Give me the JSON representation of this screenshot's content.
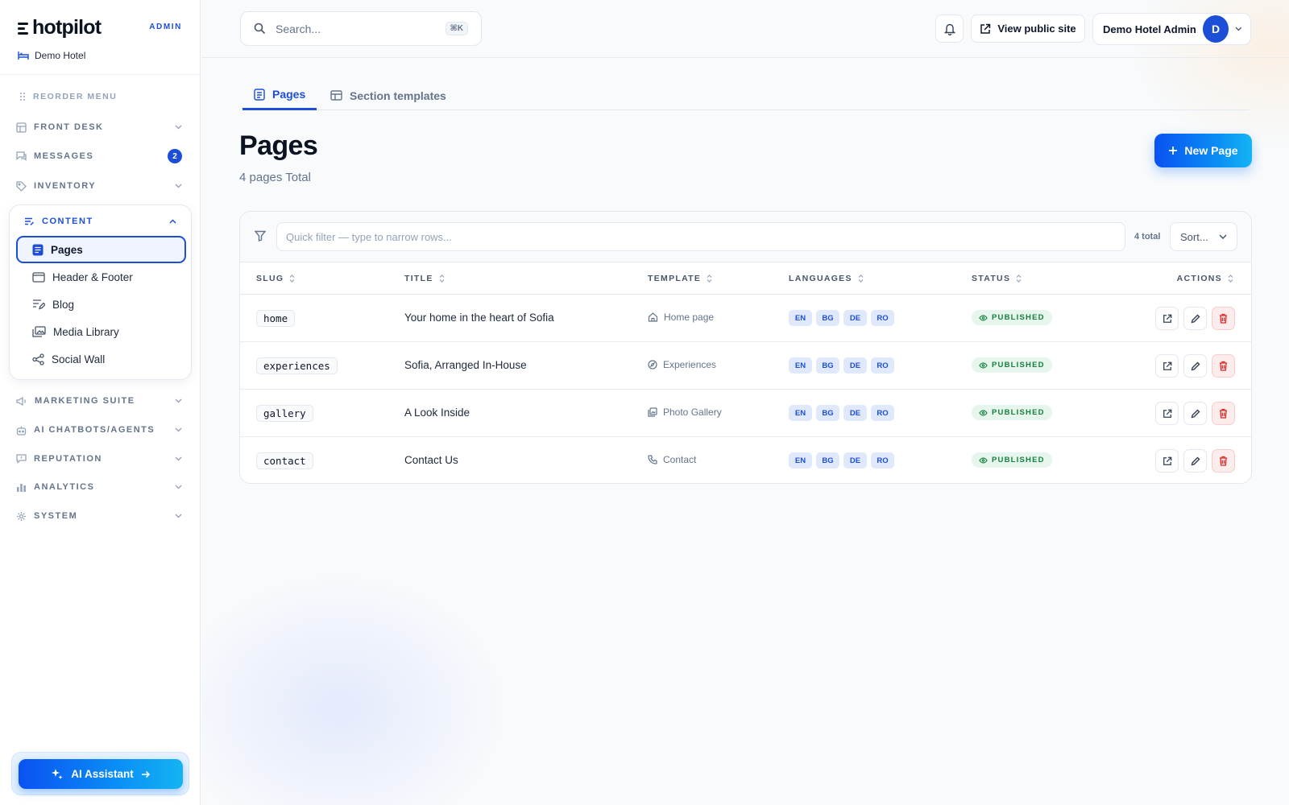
{
  "brand": {
    "name": "hotpilot",
    "role_tag": "ADMIN",
    "hotel": "Demo Hotel"
  },
  "sidebar": {
    "reorder_label": "REORDER MENU",
    "sections_top": [
      {
        "label": "FRONT DESK",
        "icon": "grid-icon"
      },
      {
        "label": "MESSAGES",
        "icon": "chat-icon",
        "badge": "2"
      },
      {
        "label": "INVENTORY",
        "icon": "tag-icon"
      }
    ],
    "content": {
      "label": "CONTENT",
      "items": [
        {
          "label": "Pages",
          "icon": "document-icon",
          "active": true
        },
        {
          "label": "Header & Footer",
          "icon": "window-icon"
        },
        {
          "label": "Blog",
          "icon": "edit-lines-icon"
        },
        {
          "label": "Media Library",
          "icon": "images-icon"
        },
        {
          "label": "Social Wall",
          "icon": "share-icon"
        }
      ]
    },
    "sections_bottom": [
      {
        "label": "MARKETING SUITE",
        "icon": "megaphone-icon"
      },
      {
        "label": "AI CHATBOTS/AGENTS",
        "icon": "bot-icon"
      },
      {
        "label": "REPUTATION",
        "icon": "review-icon"
      },
      {
        "label": "ANALYTICS",
        "icon": "bar-chart-icon"
      },
      {
        "label": "SYSTEM",
        "icon": "gear-icon"
      }
    ],
    "ai_assistant_label": "AI Assistant"
  },
  "topbar": {
    "search_placeholder": "Search...",
    "search_shortcut": "⌘K",
    "view_public_label": "View public site",
    "user_name": "Demo Hotel Admin",
    "user_initial": "D"
  },
  "tabs": [
    {
      "label": "Pages",
      "active": true
    },
    {
      "label": "Section templates",
      "active": false
    }
  ],
  "page": {
    "title": "Pages",
    "subtitle": "4 pages Total",
    "new_button_label": "New Page"
  },
  "table": {
    "filter_placeholder": "Quick filter — type to narrow rows...",
    "total_label": "4 total",
    "sort_label": "Sort...",
    "columns": [
      "SLUG",
      "TITLE",
      "TEMPLATE",
      "LANGUAGES",
      "STATUS",
      "ACTIONS"
    ],
    "rows": [
      {
        "slug": "home",
        "title": "Your home in the heart of Sofia",
        "template": "Home page",
        "template_icon": "house-icon",
        "languages": [
          "EN",
          "BG",
          "DE",
          "RO"
        ],
        "status": "PUBLISHED"
      },
      {
        "slug": "experiences",
        "title": "Sofia, Arranged In-House",
        "template": "Experiences",
        "template_icon": "compass-icon",
        "languages": [
          "EN",
          "BG",
          "DE",
          "RO"
        ],
        "status": "PUBLISHED"
      },
      {
        "slug": "gallery",
        "title": "A Look Inside",
        "template": "Photo Gallery",
        "template_icon": "gallery-icon",
        "languages": [
          "EN",
          "BG",
          "DE",
          "RO"
        ],
        "status": "PUBLISHED"
      },
      {
        "slug": "contact",
        "title": "Contact Us",
        "template": "Contact",
        "template_icon": "phone-icon",
        "languages": [
          "EN",
          "BG",
          "DE",
          "RO"
        ],
        "status": "PUBLISHED"
      }
    ]
  },
  "colors": {
    "accent": "#1d4ed8",
    "published_bg": "#e7f6ed",
    "published_text": "#15803d",
    "danger_bg": "#fdecec",
    "danger_icon": "#dc2626"
  }
}
